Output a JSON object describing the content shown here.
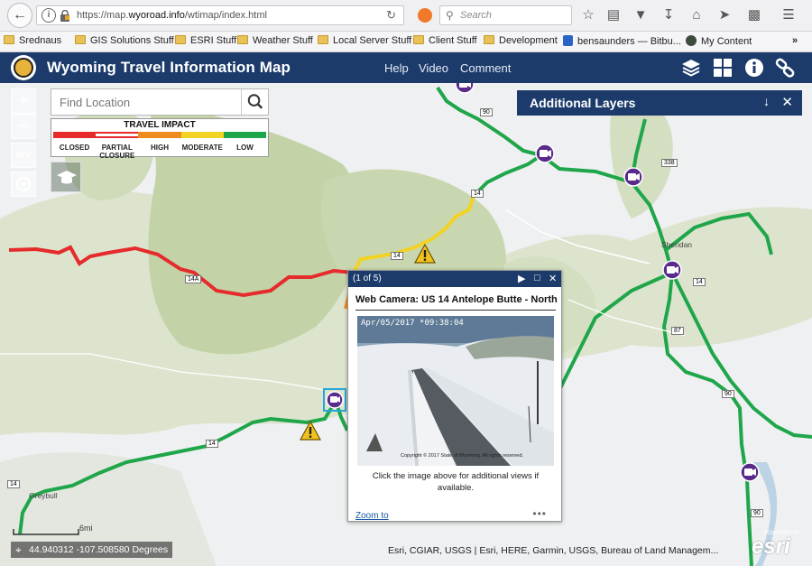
{
  "browser": {
    "url_prefix": "https://map.",
    "url_domain": "wyoroad.info",
    "url_path": "/wtimap/index.html",
    "search_placeholder": "Search"
  },
  "bookmarks": [
    {
      "label": "Srednaus"
    },
    {
      "label": "GIS Solutions Stuff"
    },
    {
      "label": "ESRI Stuff"
    },
    {
      "label": "Weather Stuff"
    },
    {
      "label": "Local Server Stuff"
    },
    {
      "label": "Client Stuff"
    },
    {
      "label": "Development"
    },
    {
      "label": "bensaunders — Bitbu..."
    },
    {
      "label": "My Content"
    }
  ],
  "bookmarks_overflow": "»",
  "app": {
    "title": "Wyoming Travel Information Map",
    "links": [
      "Help",
      "Video",
      "Comment"
    ],
    "brand_color": "#1c3b6b"
  },
  "map": {
    "find_location_placeholder": "Find Location",
    "zoom_in": "+",
    "zoom_out": "−",
    "home_label": "WY",
    "legend": {
      "title": "TRAVEL IMPACT",
      "items": [
        {
          "label": "CLOSED",
          "color": "#e52b2b"
        },
        {
          "label": "PARTIAL CLOSURE",
          "color": "#e52b2b"
        },
        {
          "label": "HIGH",
          "color": "#f08c1e"
        },
        {
          "label": "MODERATE",
          "color": "#f2d324"
        },
        {
          "label": "LOW",
          "color": "#20a64a"
        }
      ]
    },
    "additional_layers": "Additional Layers",
    "place_labels": [
      "Sheridan",
      "Greybull"
    ],
    "route_shields": [
      "90",
      "14",
      "338",
      "14",
      "14",
      "87",
      "90",
      "14A",
      "14",
      "14",
      "90"
    ],
    "coordinates": "44.940312 -107.508580 Degrees",
    "scale_label": "6mi",
    "attribution": "Esri, CGIAR, USGS | Esri, HERE, Garmin, USGS, Bureau of Land Managem...",
    "esri_powered": "POWERED BY",
    "esri_logo": "esri"
  },
  "popup": {
    "counter": "(1 of 5)",
    "title": "Web Camera: US 14 Antelope Butte - North",
    "cam_timestamp": "Apr/05/2017 *09:38:04",
    "cam_copyright": "Copyright © 2017 State of Wyoming. All rights reserved.",
    "caption": "Click the image above for additional views if available.",
    "zoom_link": "Zoom to",
    "more": "•••"
  }
}
